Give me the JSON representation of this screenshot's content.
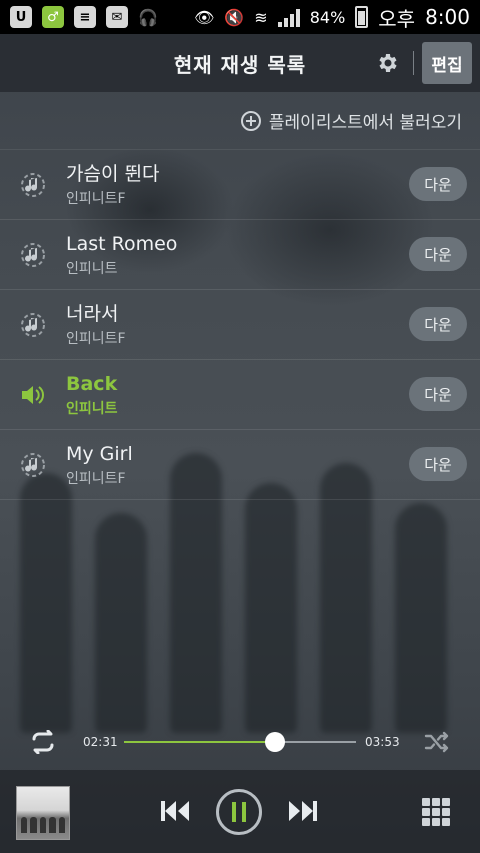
{
  "status_bar": {
    "battery_text": "84%",
    "ampm": "오후",
    "time": "8:00"
  },
  "header": {
    "title": "현재 재생 목록",
    "edit_label": "편집"
  },
  "load_playlist_label": "플레이리스트에서 불러오기",
  "tracks": [
    {
      "title": "가슴이 뛴다",
      "artist": "인피니트F",
      "download_label": "다운",
      "active": false
    },
    {
      "title": "Last Romeo",
      "artist": "인피니트",
      "download_label": "다운",
      "active": false
    },
    {
      "title": "너라서",
      "artist": "인피니트F",
      "download_label": "다운",
      "active": false
    },
    {
      "title": "Back",
      "artist": "인피니트",
      "download_label": "다운",
      "active": true
    },
    {
      "title": "My Girl",
      "artist": "인피니트F",
      "download_label": "다운",
      "active": false
    }
  ],
  "player": {
    "current_time": "02:31",
    "total_time": "03:53",
    "progress_fraction": 0.65
  },
  "colors": {
    "accent": "#8dc63f",
    "header_bg": "#2d3237",
    "button_bg": "#6b737a"
  },
  "icons": [
    "music-note-icon",
    "speaker-icon",
    "gear-icon",
    "plus-circle-icon",
    "repeat-icon",
    "shuffle-icon",
    "previous-icon",
    "pause-icon",
    "next-icon",
    "grid-menu-icon"
  ]
}
